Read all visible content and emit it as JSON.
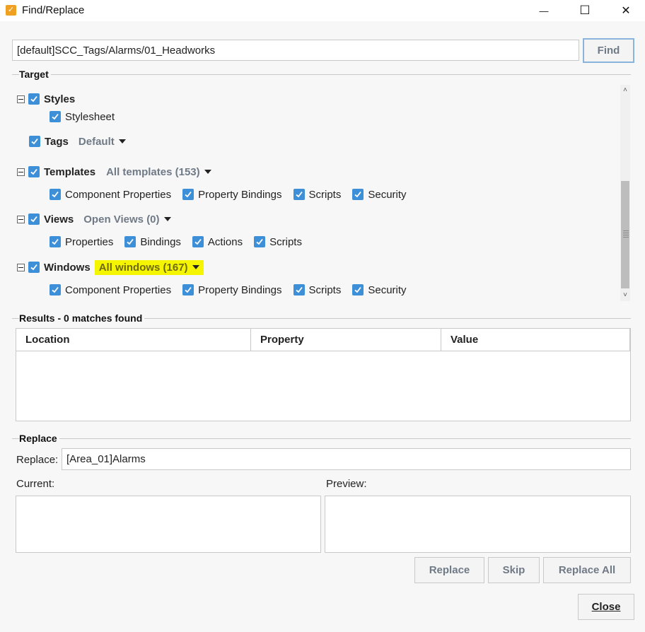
{
  "window": {
    "title": "Find/Replace",
    "app_icon_glyph": "✓",
    "minimize_glyph": "—",
    "maximize_glyph": "☐",
    "close_glyph": "✕"
  },
  "find": {
    "value": "[default]SCC_Tags/Alarms/01_Headworks",
    "button_label": "Find"
  },
  "target": {
    "label": "Target",
    "styles": {
      "label": "Styles",
      "children": [
        "Stylesheet"
      ]
    },
    "tags": {
      "label": "Tags",
      "dropdown": "Default"
    },
    "templates": {
      "label": "Templates",
      "dropdown": "All templates (153)",
      "children": [
        "Component Properties",
        "Property Bindings",
        "Scripts",
        "Security"
      ]
    },
    "views": {
      "label": "Views",
      "dropdown": "Open Views (0)",
      "children": [
        "Properties",
        "Bindings",
        "Actions",
        "Scripts"
      ]
    },
    "windows": {
      "label": "Windows",
      "dropdown": "All windows (167)",
      "children": [
        "Component Properties",
        "Property Bindings",
        "Scripts",
        "Security"
      ]
    }
  },
  "results": {
    "label": "Results - 0 matches found",
    "columns": [
      "Location",
      "Property",
      "Value"
    ]
  },
  "replace": {
    "section_label": "Replace",
    "field_label": "Replace:",
    "value": "[Area_01]Alarms",
    "current_label": "Current:",
    "preview_label": "Preview:",
    "replace_button": "Replace",
    "skip_button": "Skip",
    "replace_all_button": "Replace All"
  },
  "close_button": "Close",
  "colors": {
    "checkbox": "#3d8fd8",
    "highlight": "#f5f500",
    "disabled_text": "#6f7a86"
  }
}
